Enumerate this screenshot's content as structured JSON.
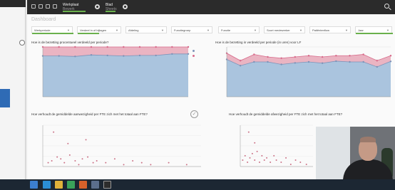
{
  "topbar": {
    "app_name": "Werkplaat",
    "app_sub": "Bewerk",
    "sheet_name": "Blad",
    "sheet_sub": "Sheets"
  },
  "sheet": {
    "title": "Dashboard"
  },
  "filters": [
    {
      "label": "Werkperiode",
      "selected": true
    },
    {
      "label": "Verdeel in of bijlagen",
      "selected": true
    },
    {
      "label": "Afdeling",
      "selected": false
    },
    {
      "label": "Functiegroep",
      "selected": false
    },
    {
      "label": "Functie",
      "selected": false
    },
    {
      "label": "Soort medewerker",
      "selected": false
    },
    {
      "label": "Patiëntenflow",
      "selected": false
    },
    {
      "label": "Jaar",
      "selected": true
    }
  ],
  "cards": {
    "top_left_title": "Hoe is de bezetting procentueel verdeeld per periode?",
    "top_right_title": "Hoe is de bezetting in verdeeld per periode (in uren) voor LF",
    "bottom_left_title": "Hoe verhoudt de gemiddelde aanwezigheid per FTE zich met het totaal aan FTE?",
    "bottom_right_title": "Hoe verhoudt de gemiddelde afwezigheid per FTE zich met het totaal aan FTE?",
    "bottom_left_sub": "",
    "bottom_right_sub": ""
  },
  "colors": {
    "accent_green": "#6ab04c",
    "series_blue": "#aac4de",
    "series_pink": "#eab4c2",
    "line_blue": "#7d93b8",
    "line_pink": "#d86a8a",
    "scatter": "#c0506a"
  },
  "chart_data": [
    {
      "type": "area",
      "title": "Hoe is de bezetting procentueel verdeeld per periode?",
      "series": [
        {
          "values": [
            82,
            82,
            81,
            84,
            83,
            82,
            83,
            83,
            86,
            86
          ]
        },
        {
          "values": [
            18,
            18,
            19,
            16,
            17,
            18,
            17,
            17,
            14,
            14
          ]
        }
      ],
      "ylim": [
        0,
        100
      ]
    },
    {
      "type": "area",
      "title": "Hoe is de bezetting in verdeeld per periode (in uren) voor LF",
      "series": [
        {
          "values": [
            150000,
            125000,
            140000,
            140000,
            130000,
            136000,
            140000,
            135000,
            143000,
            140000,
            140000,
            120000,
            142000
          ]
        },
        {
          "values": [
            25000,
            20000,
            30000,
            20000,
            25000,
            24000,
            25000,
            25000,
            22000,
            25000,
            30000,
            25000,
            23000
          ]
        }
      ],
      "ylim": [
        0,
        200000
      ]
    },
    {
      "type": "scatter",
      "title": "Hoe verhoudt de gemiddelde aanwezigheid per FTE zich met het totaal aan FTE?",
      "points": [
        [
          3,
          0.2
        ],
        [
          5,
          0.3
        ],
        [
          8,
          0.5
        ],
        [
          10,
          0.4
        ],
        [
          12,
          0.2
        ],
        [
          15,
          0.6
        ],
        [
          18,
          0.3
        ],
        [
          20,
          0.1
        ],
        [
          22,
          0.4
        ],
        [
          25,
          0.5
        ],
        [
          28,
          0.2
        ],
        [
          30,
          0.3
        ],
        [
          35,
          0.2
        ],
        [
          40,
          0.4
        ],
        [
          45,
          0.1
        ],
        [
          50,
          0.3
        ],
        [
          55,
          0.2
        ],
        [
          60,
          0.1
        ],
        [
          70,
          0.2
        ],
        [
          80,
          0.1
        ],
        [
          6,
          1.8
        ],
        [
          14,
          1.2
        ],
        [
          24,
          1.4
        ]
      ]
    },
    {
      "type": "scatter",
      "title": "Hoe verhoudt de gemiddelde afwezigheid per FTE zich met het totaal aan FTE?",
      "points": [
        [
          2,
          0.3
        ],
        [
          4,
          0.5
        ],
        [
          6,
          0.2
        ],
        [
          8,
          0.4
        ],
        [
          10,
          0.6
        ],
        [
          12,
          0.3
        ],
        [
          14,
          0.7
        ],
        [
          16,
          0.2
        ],
        [
          18,
          0.5
        ],
        [
          20,
          0.3
        ],
        [
          22,
          0.4
        ],
        [
          25,
          0.2
        ],
        [
          28,
          0.5
        ],
        [
          30,
          0.3
        ],
        [
          34,
          0.2
        ],
        [
          38,
          0.4
        ],
        [
          42,
          0.1
        ],
        [
          46,
          0.3
        ],
        [
          50,
          0.2
        ],
        [
          55,
          0.1
        ],
        [
          7,
          1.6
        ],
        [
          12,
          1.1
        ]
      ]
    }
  ]
}
